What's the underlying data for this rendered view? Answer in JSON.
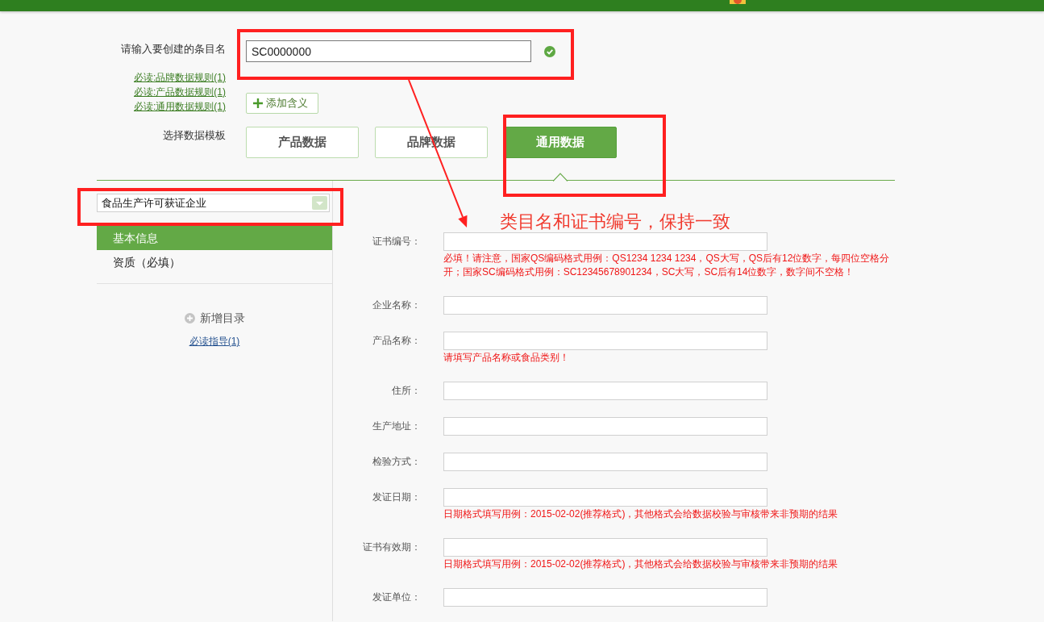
{
  "entry_name": {
    "label": "请输入要创建的条目名",
    "value": "SC0000000",
    "valid": true
  },
  "rule_links": [
    "必读:品牌数据规则(1)",
    "必读:产品数据规则(1)",
    "必读:通用数据规则(1)"
  ],
  "add_meaning_button": "添加含义",
  "template_picker": {
    "label": "选择数据模板",
    "tabs": [
      {
        "label": "产品数据",
        "selected": false
      },
      {
        "label": "品牌数据",
        "selected": false
      },
      {
        "label": "通用数据",
        "selected": true
      }
    ]
  },
  "sidebar": {
    "category": "食品生产许可获证企业",
    "items": [
      {
        "label": "基本信息",
        "selected": true
      },
      {
        "label": "资质（必填）",
        "selected": false
      }
    ],
    "add_directory": "新增目录",
    "guide_link": "必读指导(1)"
  },
  "form": {
    "fields": [
      {
        "label": "证书编号：",
        "hint": "必填！请注意，国家QS编码格式用例：QS1234 1234 1234，QS大写，QS后有12位数字，每四位空格分开；国家SC编码格式用例：SC12345678901234，SC大写，SC后有14位数字，数字间不空格！"
      },
      {
        "label": "企业名称："
      },
      {
        "label": "产品名称：",
        "hint": "请填写产品名称或食品类别！"
      },
      {
        "label": "住所："
      },
      {
        "label": "生产地址："
      },
      {
        "label": "检验方式："
      },
      {
        "label": "发证日期：",
        "hint": "日期格式填写用例：2015-02-02(推荐格式)，其他格式会给数据校验与审核带来非预期的结果"
      },
      {
        "label": "证书有效期：",
        "hint": "日期格式填写用例：2015-02-02(推荐格式)，其他格式会给数据校验与审核带来非预期的结果"
      },
      {
        "label": "发证单位："
      }
    ]
  },
  "annotation": {
    "note": "类目名和证书编号，保持一致"
  }
}
